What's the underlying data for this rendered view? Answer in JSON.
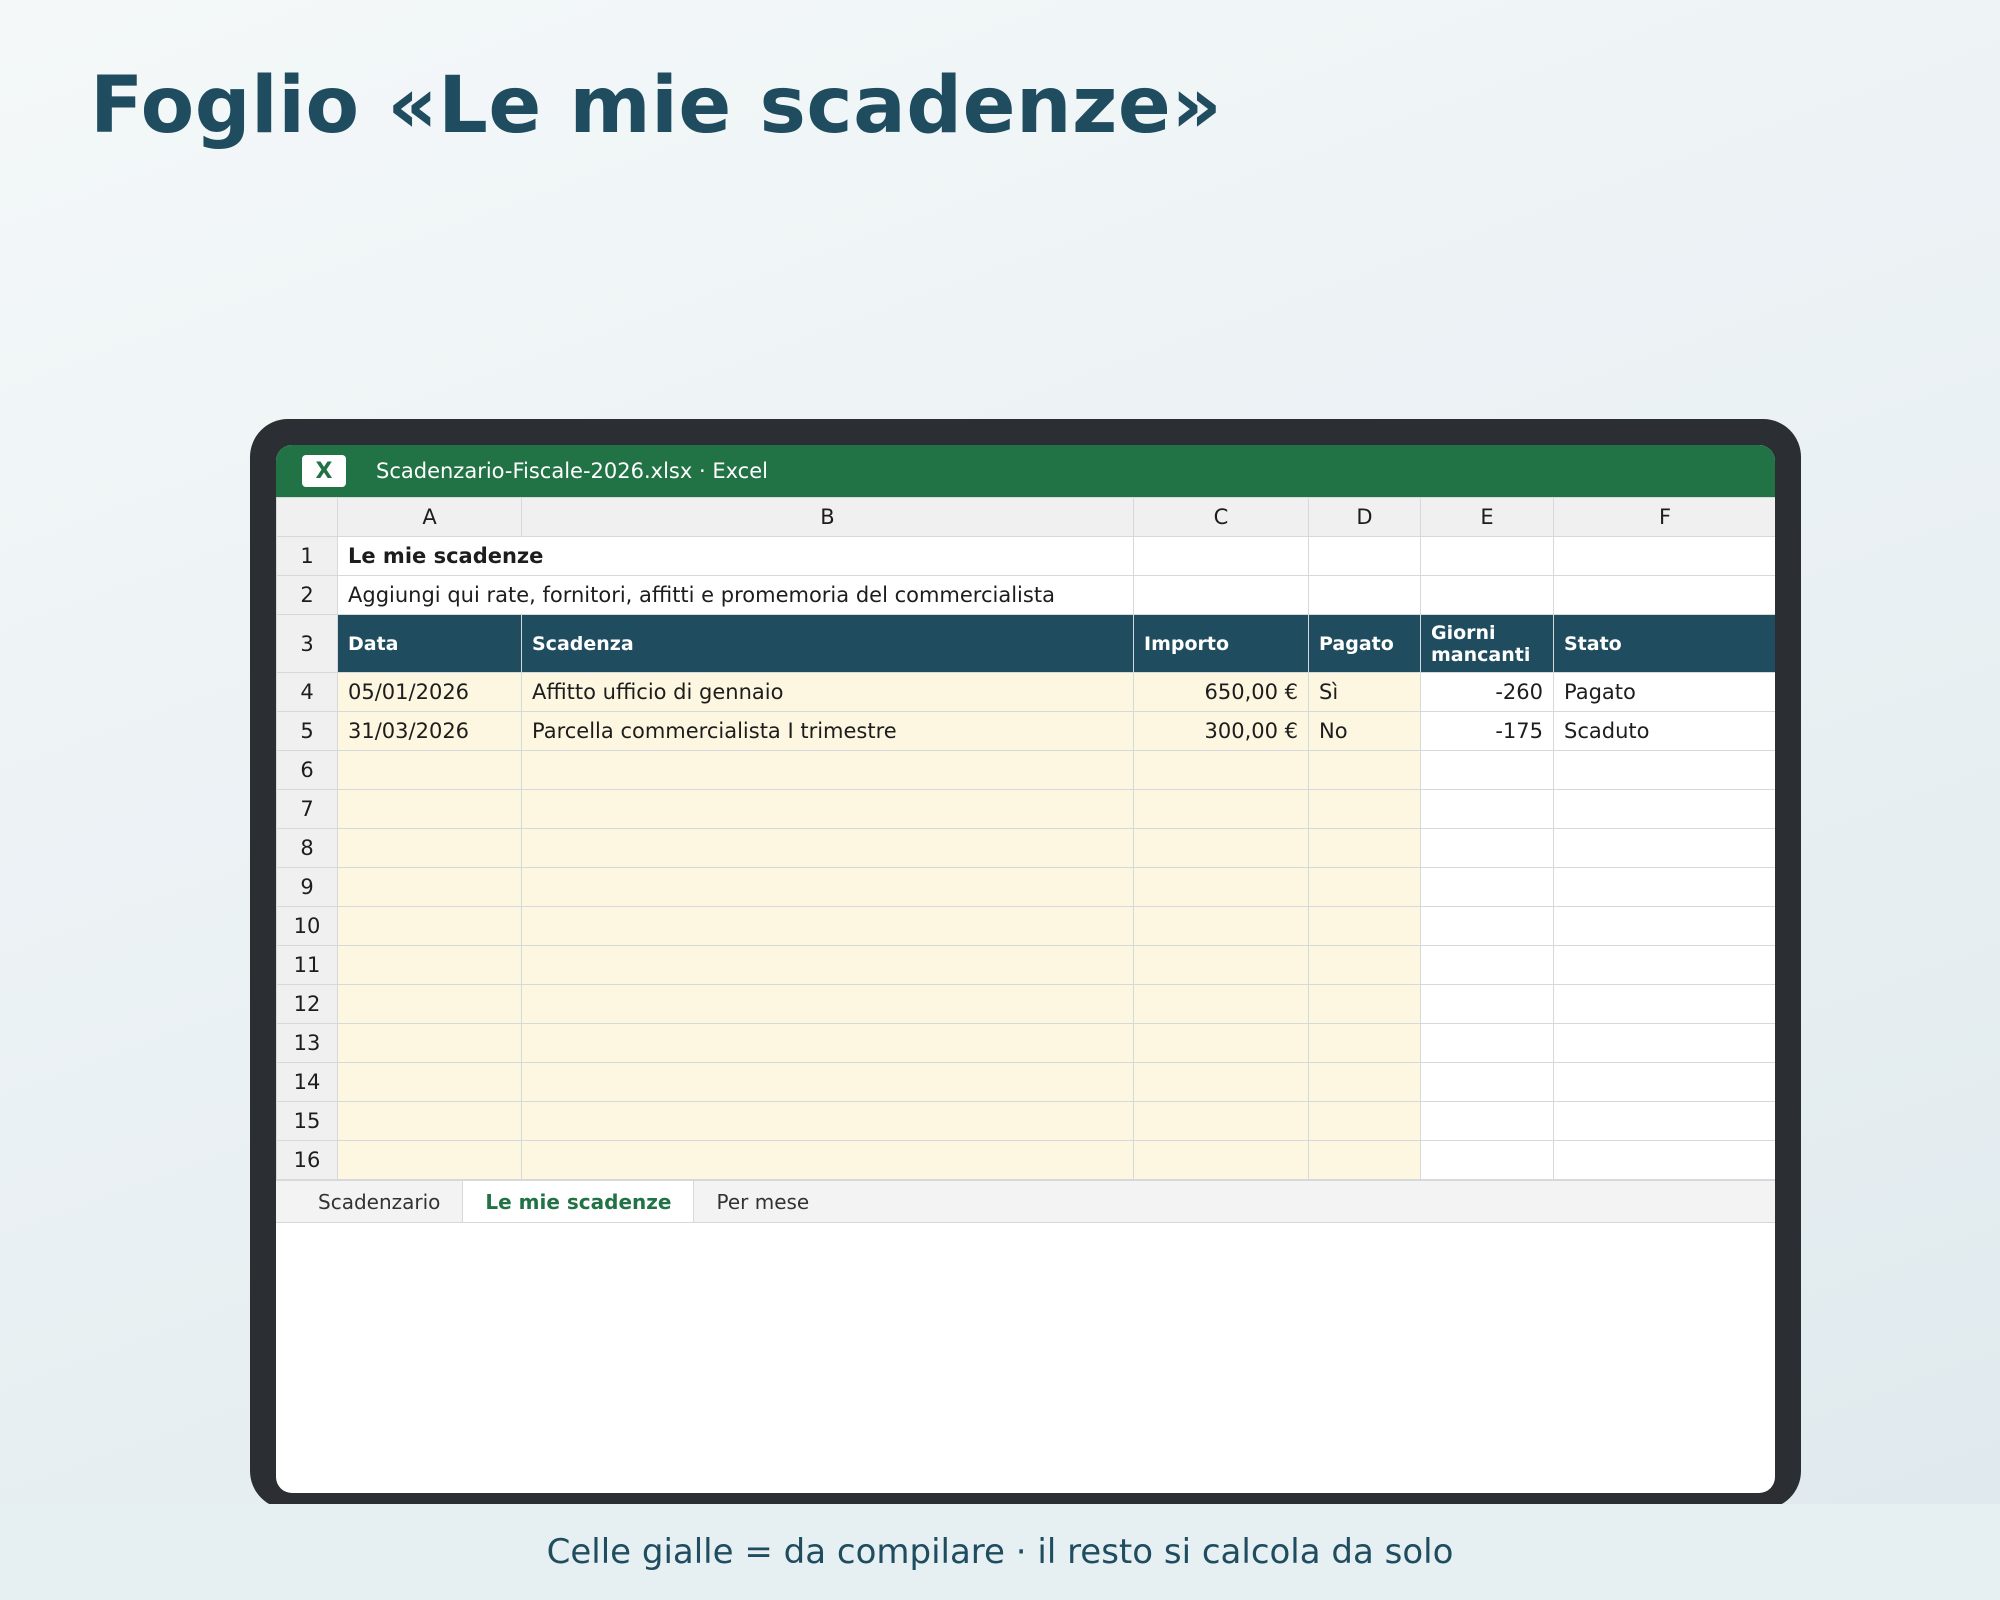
{
  "slide": {
    "title": "Foglio «Le mie scadenze»",
    "caption": "Celle gialle = da compilare · il resto si calcola da solo"
  },
  "window": {
    "logo": "X",
    "title": "Scadenzario-Fiscale-2026.xlsx · Excel"
  },
  "columns": [
    "A",
    "B",
    "C",
    "D",
    "E",
    "F"
  ],
  "sheet": {
    "title": "Le mie scadenze",
    "subtitle": "Aggiungi qui rate, fornitori, affitti e promemoria del commercialista",
    "headers": [
      "Data",
      "Scadenza",
      "Importo",
      "Pagato",
      "Giorni mancanti",
      "Stato"
    ],
    "rows": [
      {
        "data": "05/01/2026",
        "scadenza": "Affitto ufficio di gennaio",
        "importo": "650,00 €",
        "pagato": "Sì",
        "giorni": "-260",
        "stato": "Pagato"
      },
      {
        "data": "31/03/2026",
        "scadenza": "Parcella commercialista I trimestre",
        "importo": "300,00 €",
        "pagato": "No",
        "giorni": "-175",
        "stato": "Scaduto"
      }
    ],
    "row_numbers": [
      "1",
      "2",
      "3",
      "4",
      "5",
      "6",
      "7",
      "8",
      "9",
      "10",
      "11",
      "12",
      "13",
      "14",
      "15",
      "16"
    ]
  },
  "tabs": [
    {
      "label": "Scadenzario",
      "active": false
    },
    {
      "label": "Le mie scadenze",
      "active": true
    },
    {
      "label": "Per mese",
      "active": false
    }
  ],
  "colors": {
    "excel_green": "#217346",
    "header_teal": "#1f4d5f",
    "input_yellow": "#fdf6e0"
  }
}
